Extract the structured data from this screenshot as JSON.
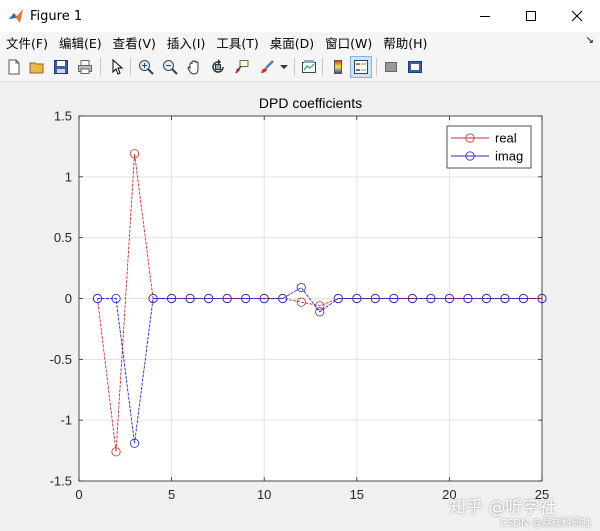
{
  "window": {
    "title": "Figure 1",
    "icon": "matlab-icon"
  },
  "menubar": {
    "items": [
      "文件(F)",
      "编辑(E)",
      "查看(V)",
      "插入(I)",
      "工具(T)",
      "桌面(D)",
      "窗口(W)",
      "帮助(H)"
    ],
    "dock_arrow": "↘"
  },
  "toolbar": {
    "icons": [
      "new-figure-icon",
      "open-file-icon",
      "save-icon",
      "print-icon",
      "pointer-icon",
      "zoom-in-icon",
      "zoom-out-icon",
      "pan-icon",
      "rotate-icon",
      "data-cursor-icon",
      "brush-icon",
      "brush-dropdown-icon",
      "link-plot-icon",
      "colorbar-icon",
      "legend-icon",
      "hide-plot-tools-icon",
      "show-plot-tools-icon"
    ],
    "active": "legend-icon"
  },
  "colors": {
    "real": "#c83232",
    "imag": "#2828c8"
  },
  "chart_data": {
    "type": "line",
    "title": "DPD coefficients",
    "xlim": [
      0,
      25
    ],
    "ylim": [
      -1.5,
      1.5
    ],
    "xticks": [
      "0",
      "5",
      "10",
      "15",
      "20",
      "25"
    ],
    "yticks": [
      "1.5",
      "1",
      "0.5",
      "0",
      "-0.5",
      "-1",
      "-1.5"
    ],
    "grid": true,
    "legend_position": "top-right",
    "x": [
      1,
      2,
      3,
      4,
      5,
      6,
      7,
      8,
      9,
      10,
      11,
      12,
      13,
      14,
      15,
      16,
      17,
      18,
      19,
      20,
      21,
      22,
      23,
      24,
      25
    ],
    "series": [
      {
        "name": "real",
        "values": [
          0,
          -1.26,
          1.19,
          0,
          0,
          0,
          0,
          0,
          0,
          0,
          0,
          -0.03,
          -0.06,
          0,
          0,
          0,
          0,
          0,
          0,
          0,
          0,
          0,
          0,
          0,
          0
        ]
      },
      {
        "name": "imag",
        "values": [
          0,
          0,
          -1.19,
          0,
          0,
          0,
          0,
          0,
          0,
          0,
          0,
          0.09,
          -0.11,
          0,
          0,
          0,
          0,
          0,
          0,
          0,
          0,
          0,
          0,
          0,
          0
        ]
      }
    ]
  },
  "watermark": {
    "line1": "知乎 @听字社",
    "line2": "CSDN @荔枝科研社"
  }
}
